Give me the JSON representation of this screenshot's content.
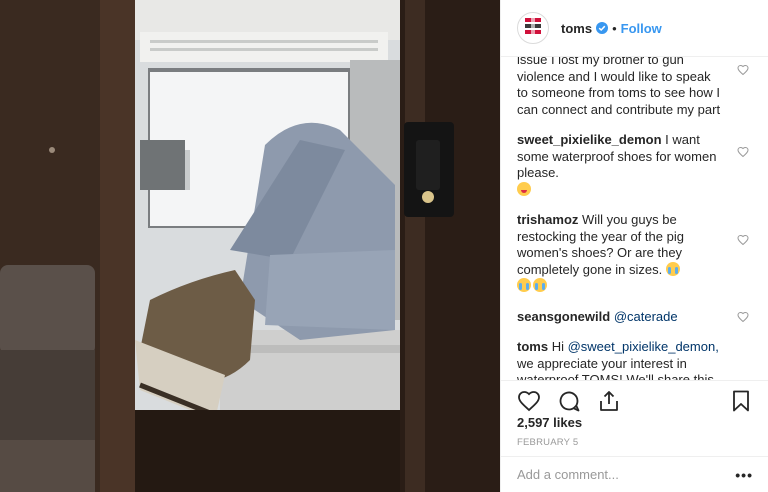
{
  "post": {
    "username": "toms",
    "follow_label": "Follow",
    "dot": "•",
    "likes": "2,597 likes",
    "date": "FEBRUARY 5",
    "add_comment_placeholder": "Add a comment...",
    "more_label": "•••"
  },
  "comments": [
    {
      "user": "",
      "text": "issue I lost my brother to gun violence and I would like to speak to someone from toms to see how I can connect and contribute my part"
    },
    {
      "user": "sweet_pixielike_demon",
      "text": "I want some waterproof shoes for women please.",
      "emoji": "yum"
    },
    {
      "user": "trishamoz",
      "text": "Will you guys be restocking the year of the pig women's shoes? Or are they completely gone in sizes.",
      "emoji": "cry"
    },
    {
      "user": "seansgonewild",
      "mention": "@caterade",
      "text": ""
    },
    {
      "user": "toms",
      "text_pre": "Hi",
      "mention": "@sweet_pixielike_demon,",
      "text": "we appreciate your interest in waterproof TOMS! We'll share this info with the team so they are aware of the demand! Please feel free to PM (private message) us on Twitter or Facebook if you have any questions or concerns. Thank you! -Frankie"
    }
  ],
  "colors": {
    "link": "#3897f0",
    "mention": "#003569",
    "verified": "#3897f0",
    "text": "#262626",
    "muted": "#999999"
  },
  "icons": [
    "toms-logo-icon",
    "verified-badge-icon",
    "heart-icon",
    "comment-icon",
    "share-icon",
    "bookmark-icon"
  ]
}
